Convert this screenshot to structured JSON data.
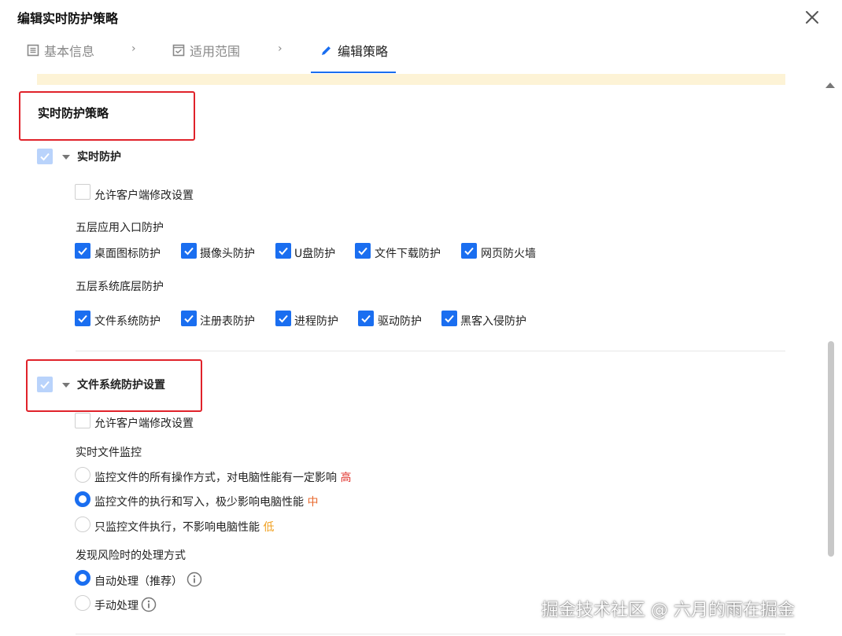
{
  "dialog": {
    "title": "编辑实时防护策略"
  },
  "steps": [
    {
      "label": "基本信息",
      "icon": "list-icon",
      "active": false
    },
    {
      "label": "适用范围",
      "icon": "checkbox-square-icon",
      "active": false
    },
    {
      "label": "编辑策略",
      "icon": "pencil-icon",
      "active": true
    }
  ],
  "realtime": {
    "section_title": "实时防护策略",
    "toggle_label": "实时防护",
    "allow_client_label": "允许客户端修改设置",
    "app_group_label": "五层应用入口防护",
    "app_items": [
      "桌面图标防护",
      "摄像头防护",
      "U盘防护",
      "文件下载防护",
      "网页防火墙"
    ],
    "sys_group_label": "五层系统底层防护",
    "sys_items": [
      "文件系统防护",
      "注册表防护",
      "进程防护",
      "驱动防护",
      "黑客入侵防护"
    ]
  },
  "fs": {
    "toggle_label": "文件系统防护设置",
    "allow_client_label": "允许客户端修改设置",
    "monitor_label": "实时文件监控",
    "monitor_options": [
      {
        "text": "监控文件的所有操作方式，对电脑性能有一定影响",
        "level": "高",
        "selected": false
      },
      {
        "text": "监控文件的执行和写入，极少影响电脑性能",
        "level": "中",
        "selected": true
      },
      {
        "text": "只监控文件执行，不影响电脑性能",
        "level": "低",
        "selected": false
      }
    ],
    "risk_label": "发现风险时的处理方式",
    "risk_options": [
      {
        "text": "自动处理（推荐）",
        "selected": true
      },
      {
        "text": "手动处理",
        "selected": false
      }
    ]
  },
  "watermark": "掘金技术社区 @ 六月的雨在掘金",
  "colors": {
    "accent": "#1a6ef0",
    "highlight_box": "#e0222a",
    "notice_bg": "#fdf3d6",
    "high": "#e0322b",
    "mid": "#e8692e",
    "low": "#f0a020"
  }
}
